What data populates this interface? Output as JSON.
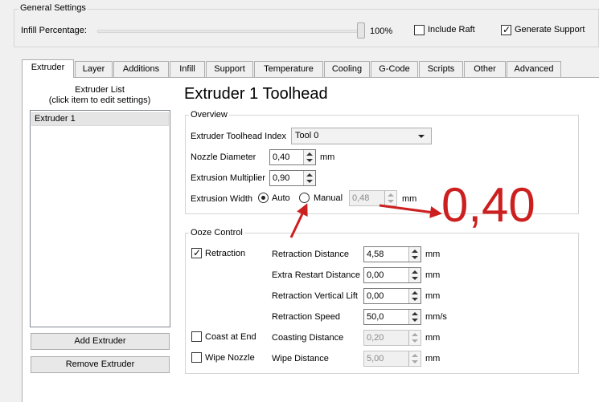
{
  "general": {
    "title": "General Settings",
    "infill_label": "Infill Percentage:",
    "infill_value": "100%",
    "infill_fraction": 1.0,
    "include_raft": {
      "label": "Include Raft",
      "checked": false
    },
    "generate_support": {
      "label": "Generate Support",
      "checked": true
    }
  },
  "tabs": [
    {
      "label": "Extruder",
      "active": true
    },
    {
      "label": "Layer"
    },
    {
      "label": "Additions"
    },
    {
      "label": "Infill"
    },
    {
      "label": "Support"
    },
    {
      "label": "Temperature"
    },
    {
      "label": "Cooling"
    },
    {
      "label": "G-Code"
    },
    {
      "label": "Scripts"
    },
    {
      "label": "Other"
    },
    {
      "label": "Advanced"
    }
  ],
  "extruder_list": {
    "title_line1": "Extruder List",
    "title_line2": "(click item to edit settings)",
    "items": [
      "Extruder 1"
    ],
    "add_button": "Add Extruder",
    "remove_button": "Remove Extruder"
  },
  "toolhead": {
    "heading": "Extruder 1 Toolhead",
    "overview": {
      "title": "Overview",
      "index_label": "Extruder Toolhead Index",
      "index_value": "Tool 0",
      "nozzle_label": "Nozzle Diameter",
      "nozzle_value": "0,40",
      "nozzle_unit": "mm",
      "multiplier_label": "Extrusion Multiplier",
      "multiplier_value": "0,90",
      "width_label": "Extrusion Width",
      "auto_label": "Auto",
      "manual_label": "Manual",
      "width_value": "0,48",
      "width_unit": "mm"
    },
    "ooze": {
      "title": "Ooze Control",
      "retraction": {
        "label": "Retraction",
        "checked": true
      },
      "coast_at_end": {
        "label": "Coast at End",
        "checked": false
      },
      "wipe_nozzle": {
        "label": "Wipe Nozzle",
        "checked": false
      },
      "rows": [
        {
          "label": "Retraction Distance",
          "value": "4,58",
          "unit": "mm",
          "enabled": true
        },
        {
          "label": "Extra Restart Distance",
          "value": "0,00",
          "unit": "mm",
          "enabled": true
        },
        {
          "label": "Retraction Vertical Lift",
          "value": "0,00",
          "unit": "mm",
          "enabled": true
        },
        {
          "label": "Retraction Speed",
          "value": "50,0",
          "unit": "mm/s",
          "enabled": true
        },
        {
          "label": "Coasting Distance",
          "value": "0,20",
          "unit": "mm",
          "enabled": false
        },
        {
          "label": "Wipe Distance",
          "value": "5,00",
          "unit": "mm",
          "enabled": false
        }
      ]
    }
  },
  "annotation": {
    "text": "0,40",
    "color": "#cc1f1f"
  }
}
